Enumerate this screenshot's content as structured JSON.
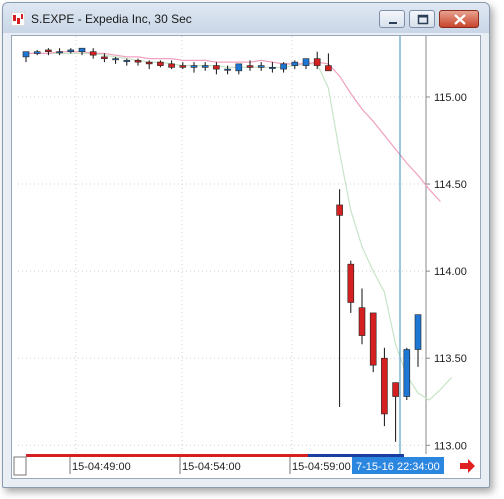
{
  "window": {
    "title": "S.EXPE - Expedia Inc, 30 Sec"
  },
  "colors": {
    "up": "#1f77d4",
    "down": "#d42020",
    "ma_fast": "#c8e4c8",
    "ma_slow": "#f0a0c0",
    "crosshair": "#3a8fb8",
    "time_tag_bg": "#2b86e0",
    "nav_arrow": "#e02020"
  },
  "chart_data": {
    "type": "candlestick",
    "symbol": "S.EXPE",
    "interval": "30 Sec",
    "ylim": [
      112.95,
      115.35
    ],
    "y_ticks": [
      "115.00",
      "114.50",
      "114.00",
      "113.50",
      "113.00"
    ],
    "x_ticks": [
      "15-04:49:00",
      "15-04:54:00",
      "15-04:59:00"
    ],
    "crosshair_time": "7-15-16 22:34:00",
    "candles": [
      {
        "o": 115.23,
        "h": 115.26,
        "l": 115.2,
        "c": 115.26
      },
      {
        "o": 115.25,
        "h": 115.27,
        "l": 115.24,
        "c": 115.26
      },
      {
        "o": 115.27,
        "h": 115.28,
        "l": 115.24,
        "c": 115.26
      },
      {
        "o": 115.26,
        "h": 115.28,
        "l": 115.24,
        "c": 115.26
      },
      {
        "o": 115.26,
        "h": 115.28,
        "l": 115.25,
        "c": 115.27
      },
      {
        "o": 115.26,
        "h": 115.28,
        "l": 115.24,
        "c": 115.28
      },
      {
        "o": 115.26,
        "h": 115.28,
        "l": 115.22,
        "c": 115.24
      },
      {
        "o": 115.23,
        "h": 115.25,
        "l": 115.2,
        "c": 115.22
      },
      {
        "o": 115.22,
        "h": 115.23,
        "l": 115.19,
        "c": 115.22
      },
      {
        "o": 115.21,
        "h": 115.22,
        "l": 115.18,
        "c": 115.21
      },
      {
        "o": 115.21,
        "h": 115.22,
        "l": 115.18,
        "c": 115.2
      },
      {
        "o": 115.2,
        "h": 115.21,
        "l": 115.16,
        "c": 115.19
      },
      {
        "o": 115.2,
        "h": 115.21,
        "l": 115.17,
        "c": 115.18
      },
      {
        "o": 115.19,
        "h": 115.21,
        "l": 115.16,
        "c": 115.17
      },
      {
        "o": 115.18,
        "h": 115.2,
        "l": 115.16,
        "c": 115.17
      },
      {
        "o": 115.17,
        "h": 115.2,
        "l": 115.14,
        "c": 115.18
      },
      {
        "o": 115.17,
        "h": 115.2,
        "l": 115.15,
        "c": 115.18
      },
      {
        "o": 115.18,
        "h": 115.2,
        "l": 115.13,
        "c": 115.16
      },
      {
        "o": 115.16,
        "h": 115.18,
        "l": 115.13,
        "c": 115.16
      },
      {
        "o": 115.15,
        "h": 115.19,
        "l": 115.13,
        "c": 115.19
      },
      {
        "o": 115.18,
        "h": 115.21,
        "l": 115.15,
        "c": 115.17
      },
      {
        "o": 115.17,
        "h": 115.2,
        "l": 115.15,
        "c": 115.18
      },
      {
        "o": 115.17,
        "h": 115.2,
        "l": 115.14,
        "c": 115.17
      },
      {
        "o": 115.16,
        "h": 115.2,
        "l": 115.14,
        "c": 115.19
      },
      {
        "o": 115.18,
        "h": 115.21,
        "l": 115.16,
        "c": 115.2
      },
      {
        "o": 115.18,
        "h": 115.22,
        "l": 115.16,
        "c": 115.22
      },
      {
        "o": 115.22,
        "h": 115.26,
        "l": 115.16,
        "c": 115.18
      },
      {
        "o": 115.18,
        "h": 115.25,
        "l": 115.15,
        "c": 115.15
      },
      {
        "o": 114.38,
        "h": 114.47,
        "l": 113.22,
        "c": 114.32
      },
      {
        "o": 114.04,
        "h": 114.06,
        "l": 113.76,
        "c": 113.82
      },
      {
        "o": 113.79,
        "h": 113.9,
        "l": 113.58,
        "c": 113.63
      },
      {
        "o": 113.76,
        "h": 113.76,
        "l": 113.42,
        "c": 113.46
      },
      {
        "o": 113.5,
        "h": 113.56,
        "l": 113.11,
        "c": 113.18
      },
      {
        "o": 113.36,
        "h": 113.36,
        "l": 113.02,
        "c": 113.28
      },
      {
        "o": 113.28,
        "h": 113.56,
        "l": 113.26,
        "c": 113.55
      },
      {
        "o": 113.55,
        "h": 113.75,
        "l": 113.45,
        "c": 113.75
      }
    ],
    "ma_fast": [
      115.25,
      115.25,
      115.25,
      115.25,
      115.25,
      115.25,
      115.25,
      115.24,
      115.23,
      115.22,
      115.21,
      115.2,
      115.2,
      115.19,
      115.18,
      115.18,
      115.18,
      115.18,
      115.17,
      115.17,
      115.17,
      115.17,
      115.17,
      115.17,
      115.18,
      115.19,
      115.19,
      115.05,
      114.68,
      114.35,
      114.14,
      114.0,
      113.88,
      113.58,
      113.4,
      113.3,
      113.26,
      113.32,
      113.39
    ],
    "ma_slow": [
      115.25,
      115.25,
      115.25,
      115.26,
      115.26,
      115.26,
      115.25,
      115.25,
      115.24,
      115.23,
      115.23,
      115.22,
      115.22,
      115.22,
      115.21,
      115.21,
      115.21,
      115.2,
      115.2,
      115.2,
      115.2,
      115.21,
      115.2,
      115.19,
      115.19,
      115.19,
      115.2,
      115.19,
      115.12,
      115.02,
      114.93,
      114.86,
      114.78,
      114.7,
      114.62,
      114.55,
      114.47,
      114.4
    ]
  }
}
